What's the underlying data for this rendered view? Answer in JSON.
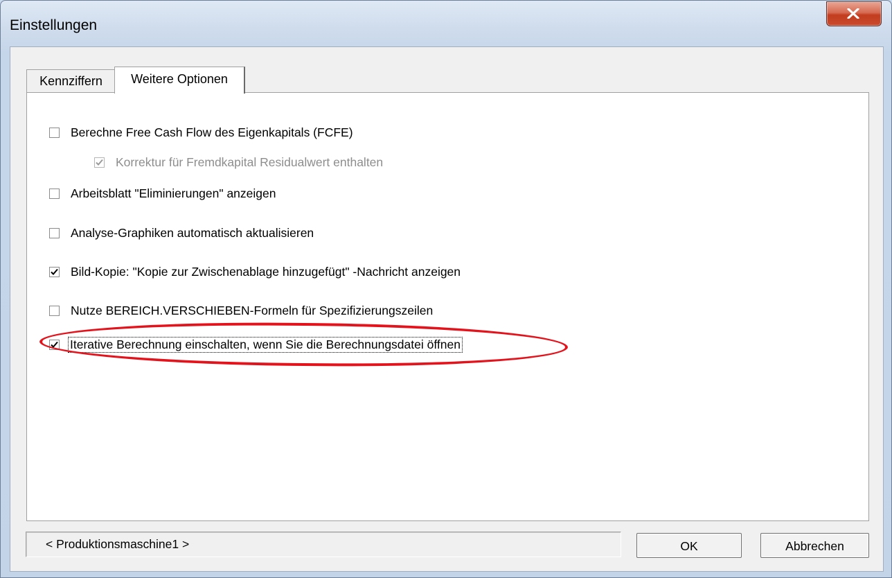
{
  "window": {
    "title": "Einstellungen"
  },
  "tabs": [
    {
      "label": "Kennziffern",
      "active": false
    },
    {
      "label": "Weitere Optionen",
      "active": true
    }
  ],
  "options": [
    {
      "label": "Berechne Free Cash Flow des Eigenkapitals (FCFE)",
      "checked": false,
      "enabled": true
    },
    {
      "label": "Korrektur für Fremdkapital Residualwert enthalten",
      "checked": true,
      "enabled": false
    },
    {
      "label": "Arbeitsblatt \"Eliminierungen\" anzeigen",
      "checked": false,
      "enabled": true
    },
    {
      "label": "Analyse-Graphiken automatisch aktualisieren",
      "checked": false,
      "enabled": true
    },
    {
      "label": "Bild-Kopie: \"Kopie zur Zwischenablage hinzugefügt\" -Nachricht anzeigen",
      "checked": true,
      "enabled": true
    },
    {
      "label": "Nutze BEREICH.VERSCHIEBEN-Formeln für Spezifizierungszeilen",
      "checked": false,
      "enabled": true
    },
    {
      "label": "Iterative Berechnung einschalten, wenn Sie die Berechnungsdatei öffnen",
      "checked": true,
      "enabled": true,
      "focused": true,
      "highlighted": true
    }
  ],
  "status": {
    "text": "< Produktionsmaschine1 >"
  },
  "buttons": {
    "ok": "OK",
    "cancel": "Abbrechen"
  },
  "colors": {
    "highlight": "#e4121b",
    "titlebar": "#cfdcec",
    "close": "#c94a2d"
  }
}
